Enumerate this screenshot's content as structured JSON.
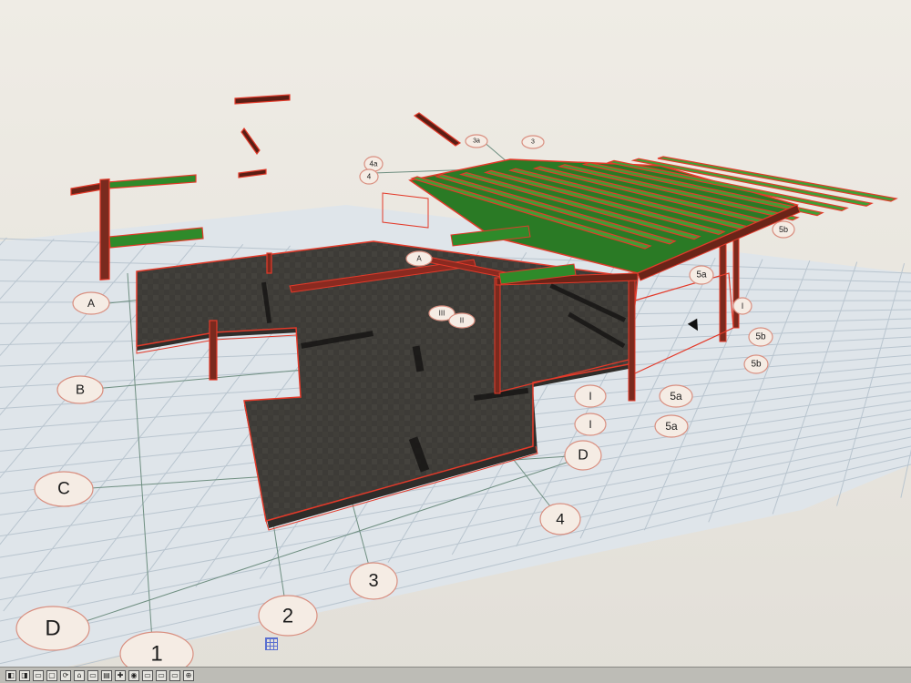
{
  "app": {
    "view_mode": "3D"
  },
  "colors": {
    "background": "#efece5",
    "grid_plane": "#dfe5ea",
    "grid_line": "#b9c5cf",
    "axis_line": "#6e8e80",
    "slab": "#3d3b37",
    "slab_edge": "#e33a2a",
    "roof_green": "#2f8a2a",
    "bubble_fill": "#f5ece4",
    "bubble_stroke": "#d98f80"
  },
  "gridlines": {
    "left_bubbles": [
      {
        "label": "A",
        "size": 12
      },
      {
        "label": "B",
        "size": 15
      },
      {
        "label": "C",
        "size": 19
      },
      {
        "label": "D",
        "size": 24
      }
    ],
    "bottom_bubbles": [
      {
        "label": "1",
        "size": 24
      },
      {
        "label": "2",
        "size": 22
      },
      {
        "label": "3",
        "size": 20
      },
      {
        "label": "4",
        "size": 17
      },
      {
        "label": "D",
        "size": 16
      }
    ],
    "right_bubbles": [
      {
        "label": "5a",
        "size": 12
      },
      {
        "label": "5a",
        "size": 12
      },
      {
        "label": "I",
        "size": 12
      },
      {
        "label": "I",
        "size": 12
      },
      {
        "label": "5b",
        "size": 10
      },
      {
        "label": "5b",
        "size": 10
      },
      {
        "label": "5b",
        "size": 9
      },
      {
        "label": "5a",
        "size": 10
      },
      {
        "label": "I",
        "size": 9
      }
    ],
    "top_bubbles": [
      {
        "label": "4a",
        "size": 8
      },
      {
        "label": "4",
        "size": 8
      },
      {
        "label": "3a",
        "size": 7
      },
      {
        "label": "3",
        "size": 7
      }
    ],
    "center_bubbles": [
      {
        "label": "III",
        "size": 8
      },
      {
        "label": "II",
        "size": 8
      },
      {
        "label": "A",
        "size": 8
      }
    ]
  },
  "statusbar": {
    "buttons": [
      "◧",
      "◨",
      "▭",
      "▢",
      "⟳",
      "⌂",
      "▭",
      "▤",
      "✚",
      "◉",
      "▭",
      "▭",
      "▭",
      "⊕"
    ]
  }
}
